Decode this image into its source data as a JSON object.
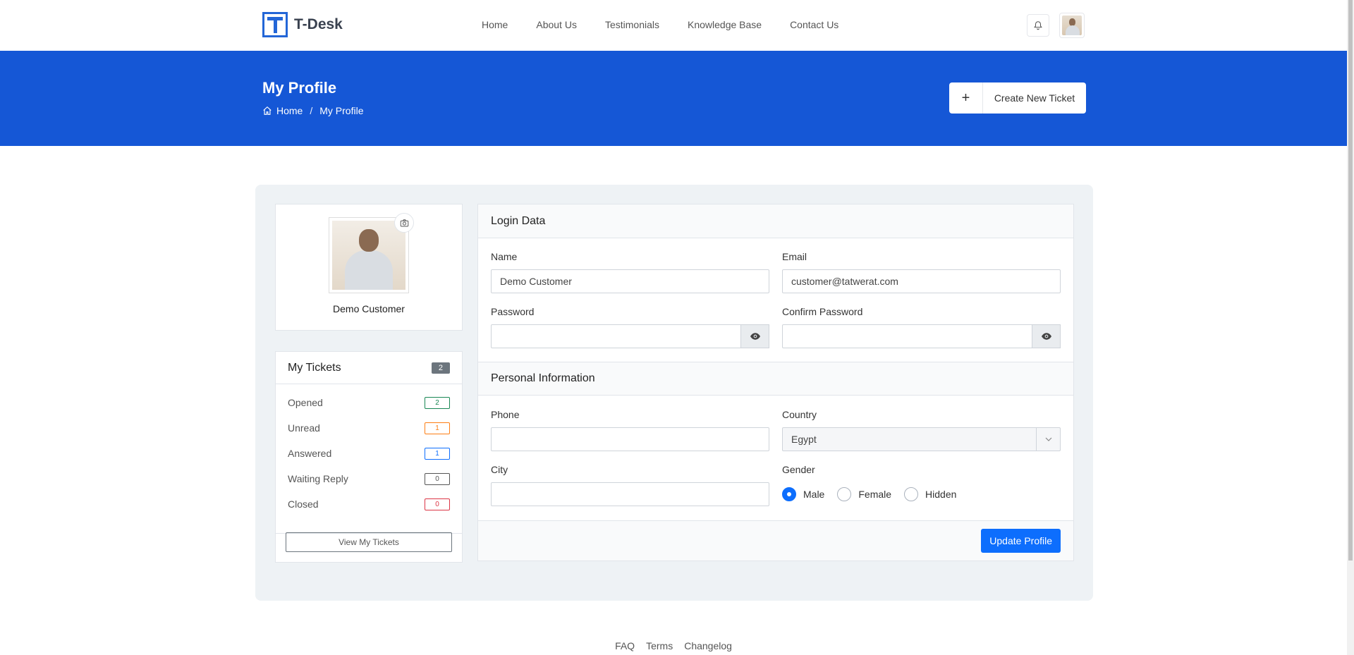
{
  "brand": {
    "name": "T-Desk"
  },
  "nav": {
    "items": [
      {
        "label": "Home"
      },
      {
        "label": "About Us"
      },
      {
        "label": "Testimonials"
      },
      {
        "label": "Knowledge Base"
      },
      {
        "label": "Contact Us"
      }
    ]
  },
  "hero": {
    "title": "My Profile",
    "breadcrumb": {
      "home": "Home",
      "sep": "/",
      "current": "My Profile"
    },
    "new_ticket_label": "Create New Ticket",
    "new_ticket_icon": "+"
  },
  "profile": {
    "name": "Demo Customer"
  },
  "tickets": {
    "title": "My Tickets",
    "total": "2",
    "rows": [
      {
        "label": "Opened",
        "count": "2",
        "color": "#198754"
      },
      {
        "label": "Unread",
        "count": "1",
        "color": "#fd7e14"
      },
      {
        "label": "Answered",
        "count": "1",
        "color": "#0d6efd"
      },
      {
        "label": "Waiting Reply",
        "count": "0",
        "color": "#555555"
      },
      {
        "label": "Closed",
        "count": "0",
        "color": "#dc3545"
      }
    ],
    "view_label": "View My Tickets"
  },
  "form": {
    "login_title": "Login Data",
    "name_label": "Name",
    "name_value": "Demo Customer",
    "email_label": "Email",
    "email_value": "customer@tatwerat.com",
    "password_label": "Password",
    "confirm_label": "Confirm Password",
    "personal_title": "Personal Information",
    "phone_label": "Phone",
    "country_label": "Country",
    "country_value": "Egypt",
    "city_label": "City",
    "gender_label": "Gender",
    "gender_options": [
      "Male",
      "Female",
      "Hidden"
    ],
    "gender_selected": "Male",
    "update_label": "Update Profile"
  },
  "footer": {
    "links": [
      "FAQ",
      "Terms",
      "Changelog"
    ]
  },
  "colors": {
    "brand": "#1557d6",
    "primary": "#0d6efd"
  }
}
